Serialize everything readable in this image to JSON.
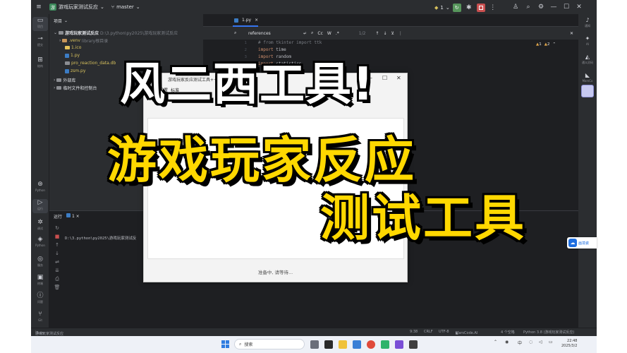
{
  "titlebar": {
    "project_badge": "游",
    "project_name": "游戏玩家测试反应",
    "branch": "master",
    "run_config": "1",
    "icons": [
      "hamburger-icon",
      "branch-icon",
      "run-icon",
      "debug-icon",
      "stop-icon",
      "more-icon",
      "user-icon",
      "search-icon",
      "gear-icon",
      "minimize-icon",
      "maximize-icon",
      "close-icon"
    ]
  },
  "left_strip": {
    "items": [
      {
        "label": "项目",
        "icon": "folder-icon"
      },
      {
        "label": "提交",
        "icon": "commit-icon"
      },
      {
        "label": "结构",
        "icon": "structure-icon"
      },
      {
        "label": "Python",
        "icon": "python-console-icon"
      },
      {
        "label": "运行",
        "icon": "run-icon"
      },
      {
        "label": "调试",
        "icon": "bug-icon"
      },
      {
        "label": "Python",
        "icon": "python-packages-icon"
      },
      {
        "label": "服务",
        "icon": "services-icon"
      },
      {
        "label": "终端",
        "icon": "terminal-icon"
      },
      {
        "label": "问题",
        "icon": "problems-icon"
      },
      {
        "label": "Git",
        "icon": "git-icon"
      }
    ]
  },
  "right_strip": {
    "items": [
      {
        "label": "通知",
        "icon": "bell-icon"
      },
      {
        "label": "AI",
        "icon": "ai-icon"
      },
      {
        "label": "通义灵码",
        "icon": "lingma-icon"
      },
      {
        "label": "MarsCo",
        "icon": "marscode-icon"
      }
    ]
  },
  "project_panel": {
    "title": "项目",
    "tree": [
      {
        "name": "游戏玩家测试反应",
        "suffix": "D:\\3.python\\py2025\\游戏玩家测试反应"
      },
      {
        "name": ".venv",
        "suffix": "library根目录"
      },
      {
        "name": "1.ico",
        "suffix": ""
      },
      {
        "name": "1.py",
        "suffix": ""
      },
      {
        "name": "pro_reaction_data.db",
        "suffix": ""
      },
      {
        "name": "zsm.py",
        "suffix": ""
      },
      {
        "name": "外部库",
        "suffix": ""
      },
      {
        "name": "临时文件和控制台",
        "suffix": ""
      }
    ]
  },
  "editor": {
    "tab_label": "1.py",
    "search_query": "references",
    "search_count": "1/2",
    "warnings": "1",
    "weak_warnings": "2",
    "line_numbers": [
      "1",
      "2",
      "3",
      "4"
    ],
    "code_lines": [
      {
        "kw": "",
        "text": "# from tkinter import ttk"
      },
      {
        "kw": "import",
        "text": " time"
      },
      {
        "kw": "import",
        "text": " random"
      },
      {
        "kw": "import",
        "text": " statistics"
      }
    ]
  },
  "run_panel": {
    "title": "运行",
    "config": "1",
    "console_line": "D:\\3.python\\py2025\\游戏玩家测试反"
  },
  "dialog": {
    "title": "游戏玩家反应测试工具++",
    "menu": [
      "设置",
      "标准"
    ],
    "status": "准备中, 请等待..."
  },
  "overlay": {
    "line1": "风二西工具!",
    "line2": "游戏玩家反应",
    "line3": "测试工具"
  },
  "side_tag": {
    "label": "画境瓷"
  },
  "status_bar": {
    "breadcrumb_project": "游戏玩家测试反应",
    "breadcrumb_file": "1.py",
    "position": "9:38",
    "line_sep": "CRLF",
    "encoding": "UTF-8",
    "plugin": "MarsCode.AI",
    "indent": "4 个空格",
    "interpreter": "Python 3.8 (游戏玩家测试反应)"
  },
  "taskbar": {
    "search_placeholder": "搜索",
    "time": "22:48",
    "date": "2025/3/2",
    "lang": "中"
  }
}
